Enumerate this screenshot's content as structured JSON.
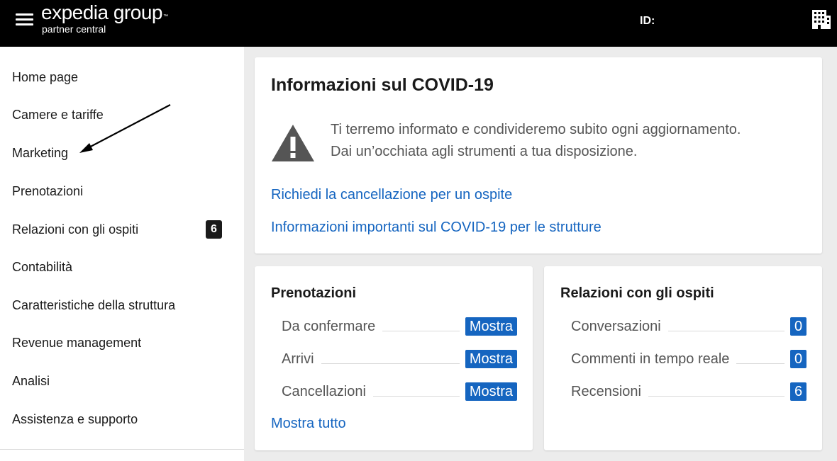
{
  "header": {
    "logo_main": "expedia group",
    "logo_tm": "™",
    "logo_sub": "partner central",
    "id_label": "ID:"
  },
  "sidebar": {
    "items": [
      {
        "label": "Home page"
      },
      {
        "label": "Camere e tariffe"
      },
      {
        "label": "Marketing"
      },
      {
        "label": "Prenotazioni"
      },
      {
        "label": "Relazioni con gli ospiti",
        "badge": "6"
      },
      {
        "label": "Contabilità"
      },
      {
        "label": "Caratteristiche della struttura"
      },
      {
        "label": "Revenue management"
      },
      {
        "label": "Analisi"
      },
      {
        "label": "Assistenza e supporto"
      }
    ]
  },
  "covid": {
    "title": "Informazioni sul COVID-19",
    "line1": "Ti terremo informato e condivideremo subito ogni aggiornamento.",
    "line2": "Dai un’occhiata agli strumenti a tua disposizione.",
    "link1": "Richiedi la cancellazione per un ospite",
    "link2": "Informazioni importanti sul COVID-19 per le strutture"
  },
  "reservations": {
    "title": "Prenotazioni",
    "rows": [
      {
        "label": "Da confermare",
        "action": "Mostra"
      },
      {
        "label": "Arrivi",
        "action": "Mostra"
      },
      {
        "label": "Cancellazioni",
        "action": "Mostra"
      }
    ],
    "show_all": "Mostra tutto"
  },
  "guest_relations": {
    "title": "Relazioni con gli ospiti",
    "rows": [
      {
        "label": "Conversazioni",
        "count": "0"
      },
      {
        "label": "Commenti in tempo reale",
        "count": "0"
      },
      {
        "label": "Recensioni",
        "count": "6"
      }
    ]
  },
  "colors": {
    "header_bg": "#000000",
    "accent_blue": "#1565c0",
    "badge_dark": "#1a1a1a",
    "page_bg": "#ececec"
  }
}
